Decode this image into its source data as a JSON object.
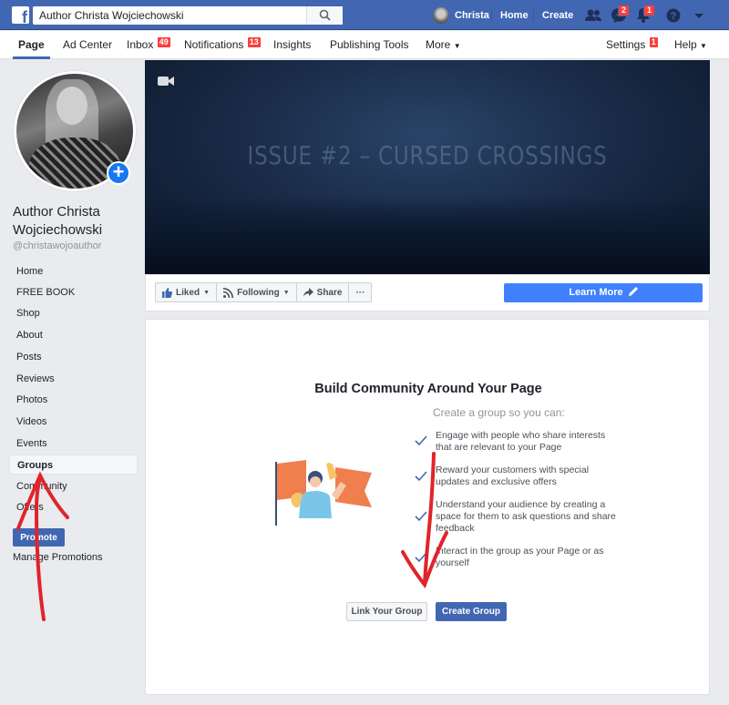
{
  "topbar": {
    "search_value": "Author Christa Wojciechowski",
    "user_name": "Christa",
    "home_label": "Home",
    "create_label": "Create",
    "messages_badge": "2",
    "notifications_badge": "1",
    "brand_color": "#4267b2"
  },
  "pagenav": {
    "page": "Page",
    "ad_center": "Ad Center",
    "inbox": "Inbox",
    "inbox_badge": "49",
    "notifications": "Notifications",
    "notifications_badge": "13",
    "insights": "Insights",
    "publishing_tools": "Publishing Tools",
    "more": "More",
    "settings": "Settings",
    "settings_badge": "1",
    "help": "Help"
  },
  "sidebar": {
    "name_line1": "Author Christa",
    "name_line2": "Wojciechowski",
    "handle": "@christawojoauthor",
    "items": [
      {
        "label": "Home"
      },
      {
        "label": "FREE BOOK"
      },
      {
        "label": "Shop"
      },
      {
        "label": "About"
      },
      {
        "label": "Posts"
      },
      {
        "label": "Reviews"
      },
      {
        "label": "Photos"
      },
      {
        "label": "Videos"
      },
      {
        "label": "Events"
      },
      {
        "label": "Groups"
      },
      {
        "label": "Community"
      },
      {
        "label": "Offers"
      }
    ],
    "promote": "Promote",
    "manage_promotions": "Manage Promotions"
  },
  "cover": {
    "title": "ISSUE #2 – CURSED CROSSINGS"
  },
  "actions": {
    "liked": "Liked",
    "following": "Following",
    "share": "Share",
    "more": "···",
    "learn_more": "Learn More"
  },
  "groups_card": {
    "title": "Build Community Around Your Page",
    "subtitle": "Create a group so you can:",
    "benefits": [
      {
        "text": "Engage with people who share interests that are relevant to your Page"
      },
      {
        "text": "Reward your customers with special updates and exclusive offers"
      },
      {
        "text": "Understand your audience by creating a space for them to ask questions and share feedback"
      },
      {
        "text": "Interact in the group as your Page or as yourself"
      }
    ],
    "link_group": "Link Your Group",
    "create_group": "Create Group"
  }
}
